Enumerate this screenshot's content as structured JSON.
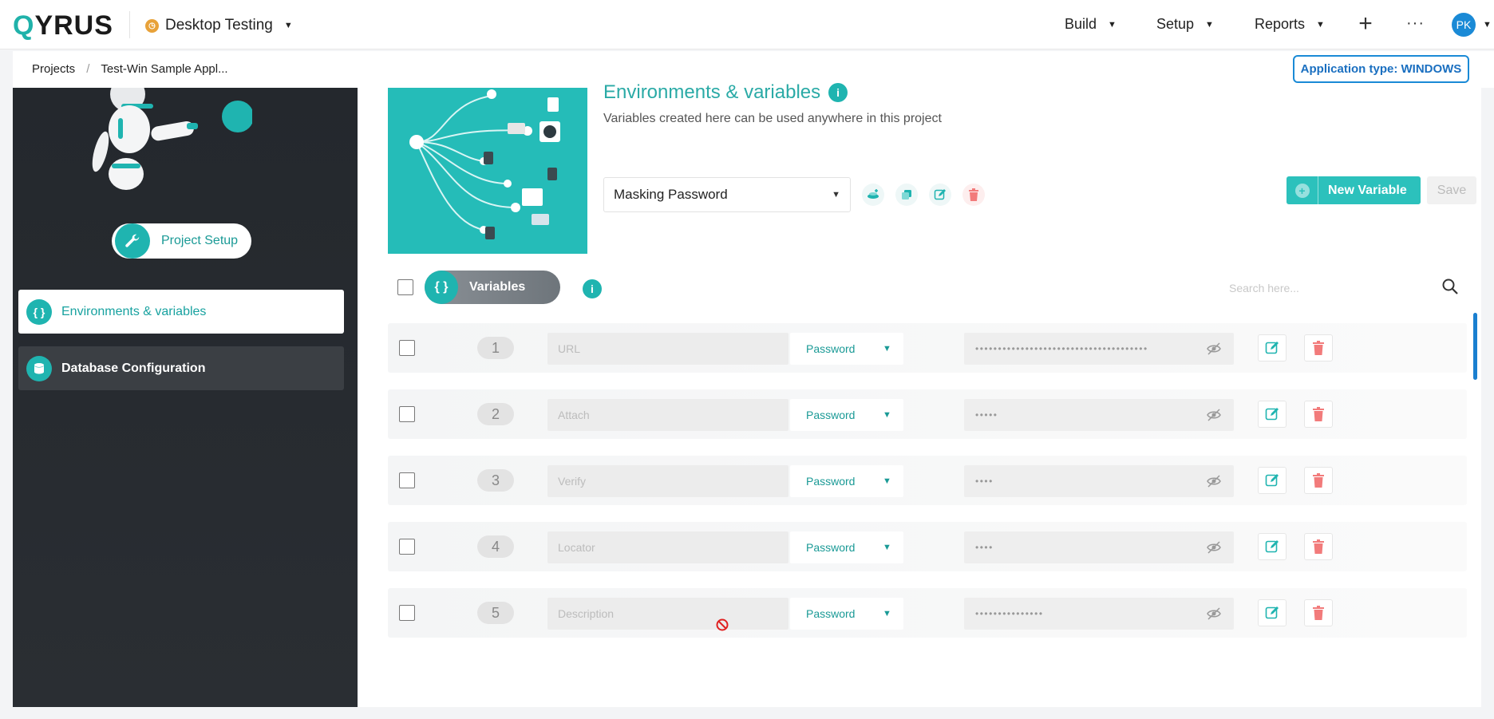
{
  "topbar": {
    "logo": "QYRUS",
    "project_name": "Desktop Testing",
    "project_icon": "clock-icon",
    "menu": [
      {
        "label": "Build"
      },
      {
        "label": "Setup"
      },
      {
        "label": "Reports"
      }
    ],
    "more": "···",
    "avatar": "PK"
  },
  "breadcrumb": {
    "items": [
      "Projects",
      "Test-Win Sample Appl..."
    ],
    "separator": "/",
    "app_type": "Application type: WINDOWS"
  },
  "sidebar": {
    "setup_button": "Project Setup",
    "items": [
      {
        "label": "Environments & variables",
        "icon": "braces-icon",
        "active": true
      },
      {
        "label": "Database Configuration",
        "icon": "database-icon",
        "active": false
      }
    ]
  },
  "main": {
    "title": "Environments & variables",
    "subtitle": "Variables created here can be used anywhere in this project",
    "environment": "Masking Password",
    "new_variable_label": "New Variable",
    "save_label": "Save",
    "variables_tab": "Variables",
    "search_placeholder": "Search here...",
    "colors": {
      "accent": "#1fb4b0",
      "link_blue": "#1a8ad6",
      "delete": "#f27b7b"
    }
  },
  "rows": [
    {
      "num": "1",
      "name": "URL",
      "type": "Password",
      "value": "••••••••••••••••••••••••••••••••••••••"
    },
    {
      "num": "2",
      "name": "Attach",
      "type": "Password",
      "value": "•••••"
    },
    {
      "num": "3",
      "name": "Verify",
      "type": "Password",
      "value": "••••"
    },
    {
      "num": "4",
      "name": "Locator",
      "type": "Password",
      "value": "••••"
    },
    {
      "num": "5",
      "name": "Description",
      "type": "Password",
      "value": "•••••••••••••••"
    }
  ]
}
